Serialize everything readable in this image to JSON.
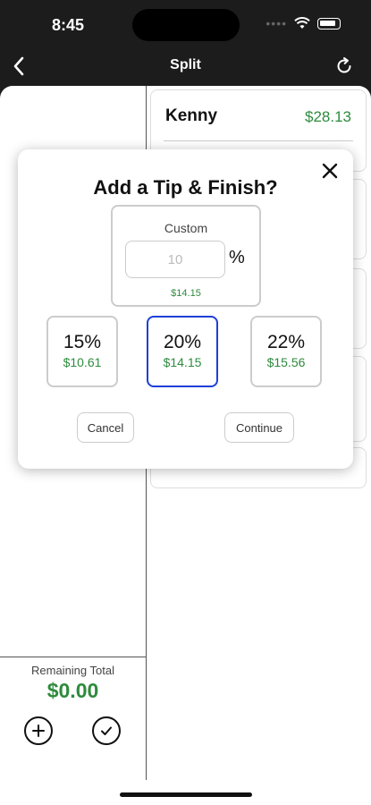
{
  "status_bar": {
    "time": "8:45"
  },
  "nav": {
    "title": "Split"
  },
  "people": [
    {
      "name": "Kenny",
      "amount": "$28.13"
    }
  ],
  "remaining": {
    "label": "Remaining Total",
    "amount": "$0.00"
  },
  "modal": {
    "title": "Add a Tip & Finish?",
    "custom": {
      "label": "Custom",
      "input_placeholder": "10",
      "percent_sign": "%",
      "amount": "$14.15"
    },
    "tip_options": [
      {
        "percent": "15%",
        "amount": "$10.61",
        "selected": false
      },
      {
        "percent": "20%",
        "amount": "$14.15",
        "selected": true
      },
      {
        "percent": "22%",
        "amount": "$15.56",
        "selected": false
      }
    ],
    "cancel_label": "Cancel",
    "continue_label": "Continue"
  },
  "colors": {
    "accent_green": "#2e8b3d",
    "selected_border": "#1e3fd9",
    "header_bg": "#1c1c1c"
  },
  "icons": {
    "back": "chevron-left-icon",
    "refresh": "refresh-icon",
    "close": "close-icon",
    "add": "plus-circle-icon",
    "done": "check-circle-icon"
  }
}
